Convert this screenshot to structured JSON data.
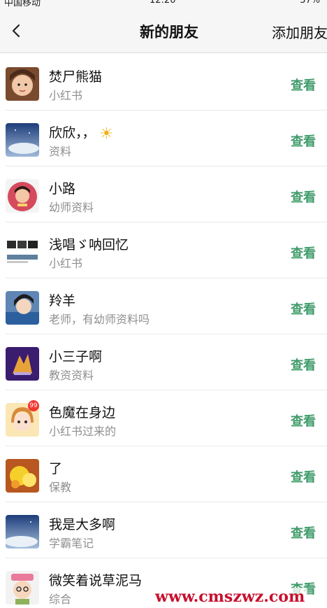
{
  "status_bar": {
    "carrier": "中国移动",
    "time": "12:20",
    "battery": "37%"
  },
  "nav": {
    "back_icon": "chevron-left-icon",
    "title": "新的朋友",
    "add_label": "添加朋友"
  },
  "friends": [
    {
      "name": "焚尸熊猫",
      "note": "小红书",
      "action": "查看"
    },
    {
      "name": "欣欣，，",
      "note": "资料",
      "action": "查看",
      "emoji": "☀"
    },
    {
      "name": "小路",
      "note": "幼师资料",
      "action": "查看"
    },
    {
      "name": "浅唱ゞ呐回忆",
      "note": "小红书",
      "action": "查看"
    },
    {
      "name": "羚羊",
      "note": "老师，有幼师资料吗",
      "action": "查看"
    },
    {
      "name": "小三子啊",
      "note": "教资资料",
      "action": "查看"
    },
    {
      "name": "色魔在身边",
      "note": "小红书过来的",
      "action": "查看",
      "badge": "99"
    },
    {
      "name": "了",
      "note": "保教",
      "action": "查看"
    },
    {
      "name": "我是大多啊",
      "note": "学霸笔记",
      "action": "查看"
    },
    {
      "name": "微笑着说草泥马",
      "note": "综合",
      "action": "查看"
    }
  ],
  "watermark": "www.cmszwz.com",
  "accent_color": "#3e9b6a"
}
